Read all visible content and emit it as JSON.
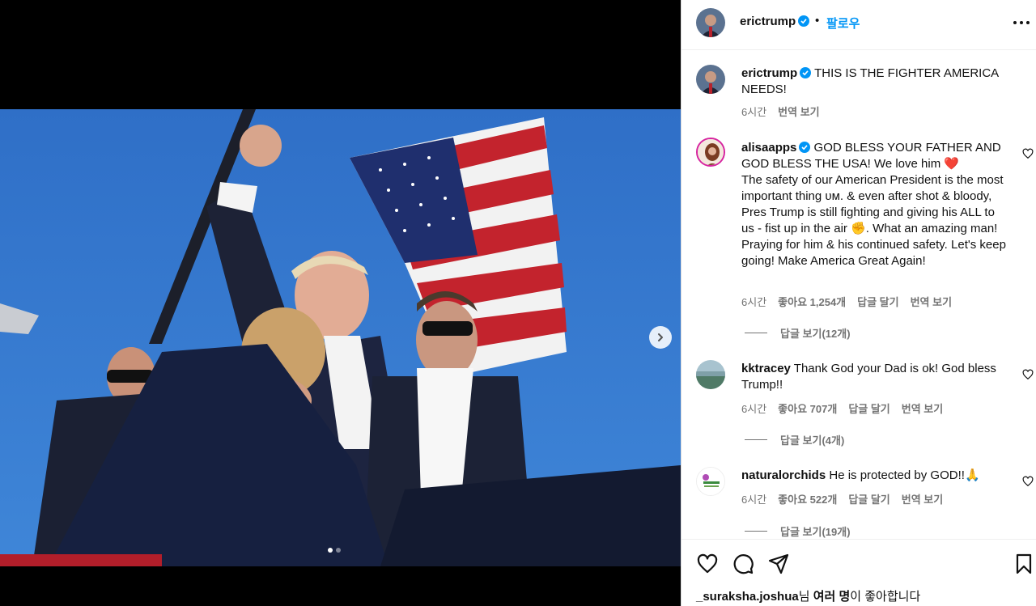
{
  "post": {
    "author": "erictrump",
    "follow_label": "팔로우",
    "separator": "•",
    "caption": "THIS IS THE FIGHTER AMERICA NEEDS!",
    "caption_time": "6시간",
    "caption_translate": "번역 보기"
  },
  "comments": [
    {
      "username": "alisaapps",
      "text_line1": "GOD BLESS YOUR FATHER AND GOD BLESS THE USA! We love him",
      "emoji1": "❤️",
      "text_line2": "The safety of our American President is the most important thing ᴜᴍ. & even after shot & bloody, Pres Trump is still fighting and giving his ALL to us - fist up in the air",
      "emoji2": "✊",
      "text_line3": ". What an amazing man! Praying for him & his continued safety. Let's keep going! Make America Great Again!",
      "time": "6시간",
      "likes": "좋아요 1,254개",
      "reply": "답글 달기",
      "translate": "번역 보기",
      "view_replies": "답글 보기(12개)"
    },
    {
      "username": "kktracey",
      "text": "Thank God your Dad is ok! God bless Trump!!",
      "time": "6시간",
      "likes": "좋아요 707개",
      "reply": "답글 달기",
      "translate": "번역 보기",
      "view_replies": "답글 보기(4개)"
    },
    {
      "username": "naturalorchids",
      "text": "He is protected by GOD!!",
      "emoji": "🙏",
      "time": "6시간",
      "likes": "좋아요 522개",
      "reply": "답글 달기",
      "translate": "번역 보기",
      "view_replies": "답글 보기(19개)"
    }
  ],
  "likes_summary": {
    "user": "_suraksha.joshua",
    "mid": "님 ",
    "bold": "여러 명",
    "end": "이 좋아합니다"
  },
  "carousel": {
    "current": 1,
    "total": 2
  },
  "icons": {
    "header": [
      "verified-badge-icon",
      "more-icon"
    ],
    "actions": [
      "heart-icon",
      "comment-icon",
      "share-icon",
      "bookmark-icon"
    ],
    "media": [
      "chevron-right-icon"
    ]
  },
  "colors": {
    "accent": "#0095f6",
    "verified": "#0095f6",
    "secondary_text": "#737373"
  }
}
